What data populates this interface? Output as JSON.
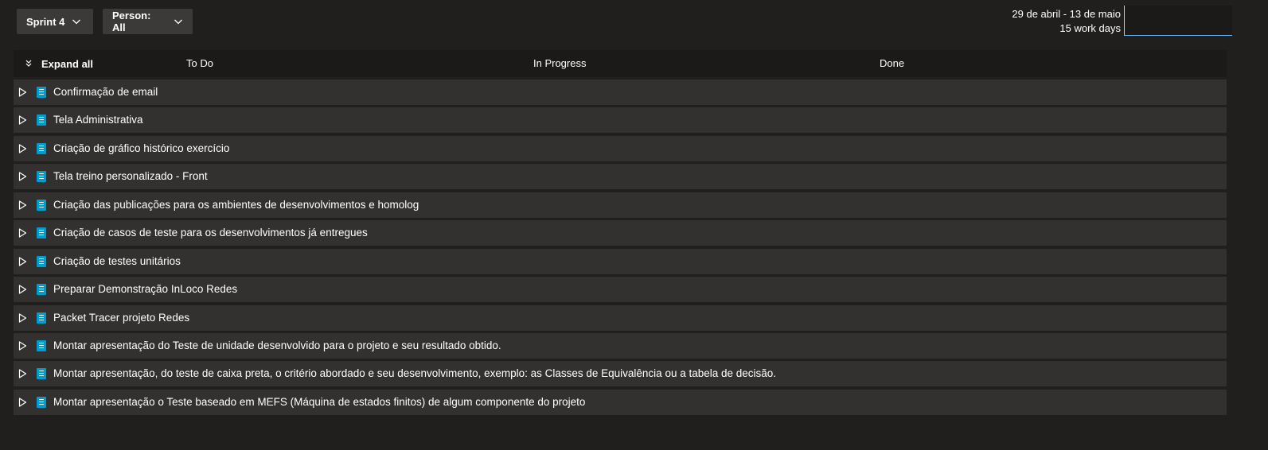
{
  "toolbar": {
    "sprint_label": "Sprint 4",
    "person_label": "Person: All"
  },
  "sprint_info": {
    "date_range": "29 de abril - 13 de maio",
    "work_days": "15 work days"
  },
  "board": {
    "expand_all_label": "Expand all",
    "columns": [
      "To Do",
      "In Progress",
      "Done"
    ]
  },
  "items": [
    {
      "title": "Confirmação de email"
    },
    {
      "title": "Tela Administrativa"
    },
    {
      "title": "Criação de gráfico histórico exercício"
    },
    {
      "title": "Tela treino personalizado - Front"
    },
    {
      "title": "Criação das publicações para os ambientes de desenvolvimentos e homolog"
    },
    {
      "title": "Criação de casos de teste para os desenvolvimentos já entregues"
    },
    {
      "title": "Criação de testes unitários"
    },
    {
      "title": "Preparar Demonstração InLoco Redes"
    },
    {
      "title": "Packet Tracer projeto Redes"
    },
    {
      "title": "Montar apresentação do Teste de unidade desenvolvido para o projeto e seu resultado obtido."
    },
    {
      "title": "Montar apresentação, do teste de caixa preta, o critério abordado e seu desenvolvimento, exemplo: as Classes de Equivalência ou a tabela de decisão."
    },
    {
      "title": "Montar apresentação o Teste baseado em MEFS (Máquina de estados finitos) de algum componente do projeto"
    }
  ],
  "colors": {
    "background": "#201f1e",
    "row_background": "#323130",
    "header_background": "#1b1a19",
    "story_icon": "#009ccc",
    "capacity_underline": "#6cb8f6"
  },
  "icons": {
    "dropdown": "chevron-down-icon",
    "expand_all": "double-chevron-down-icon",
    "row_expand": "triangle-right-icon",
    "work_item": "user-story-icon"
  }
}
